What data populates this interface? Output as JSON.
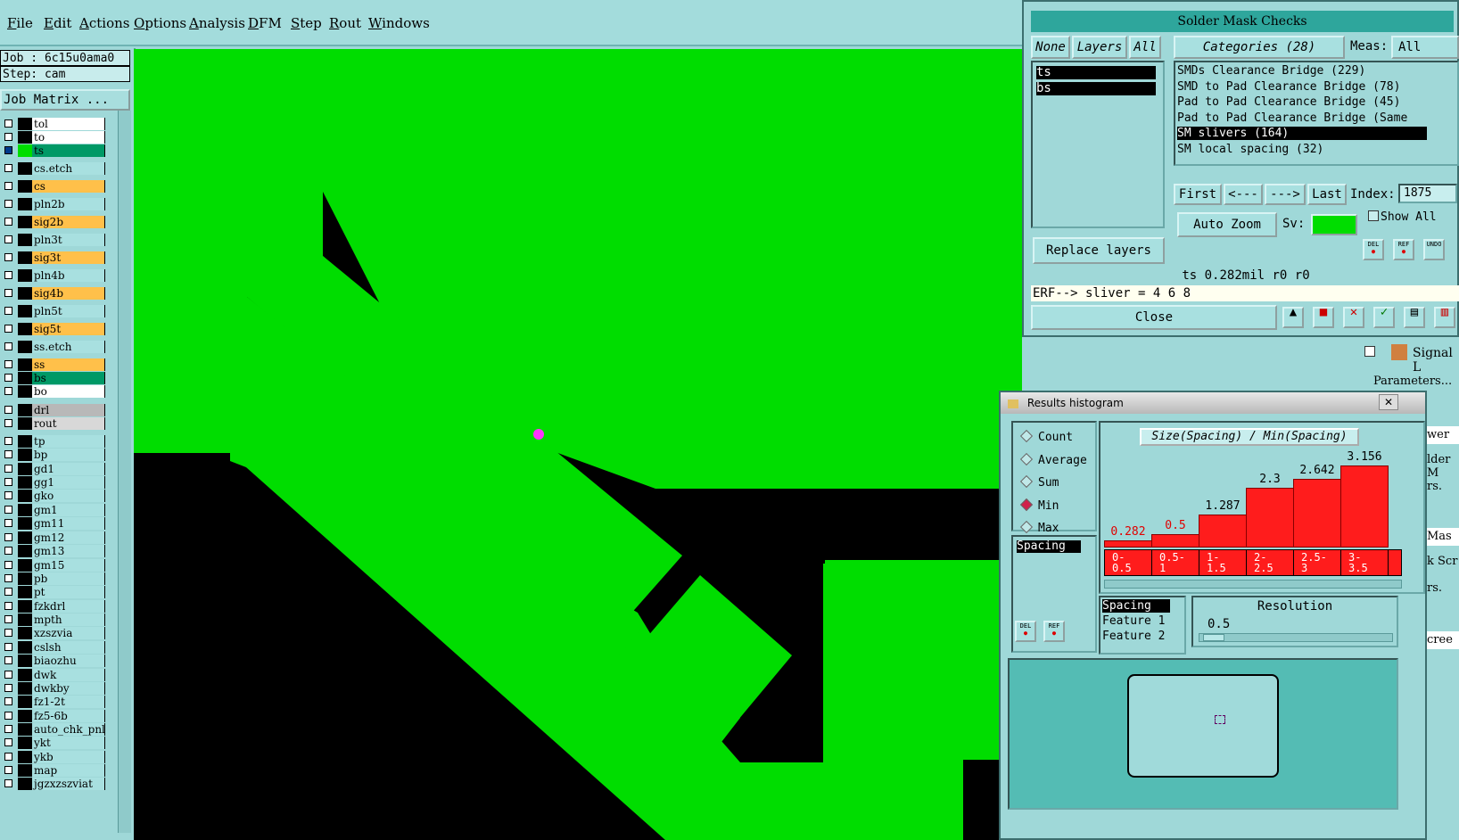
{
  "menu": [
    "File",
    "Edit",
    "Actions",
    "Options",
    "Analysis",
    "DFM",
    "Step",
    "Rout",
    "Windows"
  ],
  "job": {
    "job_line": "Job : 6c15u0ama0",
    "step_line": "Step: cam",
    "matrix_button": "Job Matrix ..."
  },
  "layers": [
    {
      "name": "tol",
      "color": "#ffffff",
      "checked": false
    },
    {
      "name": "to",
      "color": "#ffffff",
      "checked": false
    },
    {
      "name": "ts",
      "color": "#009966",
      "checked": true
    },
    {
      "name": "cs.etch",
      "color": "#a8e0e0",
      "checked": false
    },
    {
      "name": "cs",
      "color": "#ffc04a",
      "checked": false
    },
    {
      "name": "pln2b",
      "color": "#a8e0e0",
      "checked": false
    },
    {
      "name": "sig2b",
      "color": "#ffc04a",
      "checked": false
    },
    {
      "name": "pln3t",
      "color": "#a8e0e0",
      "checked": false
    },
    {
      "name": "sig3t",
      "color": "#ffc04a",
      "checked": false
    },
    {
      "name": "pln4b",
      "color": "#a8e0e0",
      "checked": false
    },
    {
      "name": "sig4b",
      "color": "#ffc04a",
      "checked": false
    },
    {
      "name": "pln5t",
      "color": "#a8e0e0",
      "checked": false
    },
    {
      "name": "sig5t",
      "color": "#ffc04a",
      "checked": false
    },
    {
      "name": "ss.etch",
      "color": "#a8e0e0",
      "checked": false
    },
    {
      "name": "ss",
      "color": "#ffc04a",
      "checked": false
    },
    {
      "name": "bs",
      "color": "#009966",
      "checked": false
    },
    {
      "name": "bo",
      "color": "#ffffff",
      "checked": false
    },
    {
      "name": "drl",
      "color": "#b8b8b8",
      "checked": false
    },
    {
      "name": "rout",
      "color": "#d8d8d8",
      "checked": false
    },
    {
      "name": "tp",
      "color": "#a8e0e0",
      "checked": false
    },
    {
      "name": "bp",
      "color": "#a8e0e0",
      "checked": false
    },
    {
      "name": "gd1",
      "color": "#a8e0e0",
      "checked": false
    },
    {
      "name": "gg1",
      "color": "#a8e0e0",
      "checked": false
    },
    {
      "name": "gko",
      "color": "#a8e0e0",
      "checked": false
    },
    {
      "name": "gm1",
      "color": "#a8e0e0",
      "checked": false
    },
    {
      "name": "gm11",
      "color": "#a8e0e0",
      "checked": false
    },
    {
      "name": "gm12",
      "color": "#a8e0e0",
      "checked": false
    },
    {
      "name": "gm13",
      "color": "#a8e0e0",
      "checked": false
    },
    {
      "name": "gm15",
      "color": "#a8e0e0",
      "checked": false
    },
    {
      "name": "pb",
      "color": "#a8e0e0",
      "checked": false
    },
    {
      "name": "pt",
      "color": "#a8e0e0",
      "checked": false
    },
    {
      "name": "fzkdrl",
      "color": "#a8e0e0",
      "checked": false
    },
    {
      "name": "mpth",
      "color": "#a8e0e0",
      "checked": false
    },
    {
      "name": "xzszvia",
      "color": "#a8e0e0",
      "checked": false
    },
    {
      "name": "cslsh",
      "color": "#a8e0e0",
      "checked": false
    },
    {
      "name": "biaozhu",
      "color": "#a8e0e0",
      "checked": false
    },
    {
      "name": "dwk",
      "color": "#a8e0e0",
      "checked": false
    },
    {
      "name": "dwkby",
      "color": "#a8e0e0",
      "checked": false
    },
    {
      "name": "fz1-2t",
      "color": "#a8e0e0",
      "checked": false
    },
    {
      "name": "fz5-6b",
      "color": "#a8e0e0",
      "checked": false
    },
    {
      "name": "auto_chk_pnl",
      "color": "#a8e0e0",
      "checked": false
    },
    {
      "name": "ykt",
      "color": "#a8e0e0",
      "checked": false
    },
    {
      "name": "ykb",
      "color": "#a8e0e0",
      "checked": false
    },
    {
      "name": "map",
      "color": "#a8e0e0",
      "checked": false
    },
    {
      "name": "jgzxzszviat",
      "color": "#a8e0e0",
      "checked": false
    }
  ],
  "sm": {
    "title": "Solder Mask Checks",
    "none": "None",
    "layers_btn": "Layers",
    "all": "All",
    "categories": "Categories (28)",
    "meas": "Meas:",
    "meas_value": "All",
    "layer_items": [
      "ts",
      "bs"
    ],
    "category_items": [
      "SMDs Clearance Bridge (229)",
      "SMD to Pad Clearance Bridge (78)",
      "Pad to Pad Clearance Bridge (45)",
      "Pad to Pad Clearance Bridge (Same",
      "SM slivers (164)",
      "SM local spacing (32)"
    ],
    "first": "First",
    "prev": "<---",
    "next": "--->",
    "last": "Last",
    "index_label": "Index:",
    "index_value": "1875",
    "auto_zoom": "Auto Zoom",
    "sv": "Sv:",
    "show_all": "Show All",
    "replace_layers": "Replace layers",
    "status": "ts 0.282mil  r0  r0",
    "erf": "ERF--> sliver = 4 6 8",
    "close": "Close",
    "del": "DEL",
    "ref": "REF",
    "undo": "UNDO"
  },
  "side": {
    "signal": "Signal L",
    "parameters": "Parameters...",
    "frag1": "wer",
    "frag2": "lder M",
    "frag3": "rs.",
    "frag4": "Mas",
    "frag5": "k Scr",
    "frag6": "rs.",
    "frag7": "cree"
  },
  "hist": {
    "title": "Results histogram",
    "radios": [
      {
        "label": "Count",
        "on": false
      },
      {
        "label": "Average",
        "on": false
      },
      {
        "label": "Sum",
        "on": false
      },
      {
        "label": "Min",
        "on": true
      },
      {
        "label": "Max",
        "on": false
      }
    ],
    "list_item": "Spacing",
    "chart_title": "Size(Spacing) / Min(Spacing)",
    "bottom_list": [
      "Spacing",
      "Feature 1",
      "Feature 2"
    ],
    "resolution_label": "Resolution",
    "resolution_value": "0.5",
    "del": "DEL",
    "ref": "REF"
  },
  "chart_data": {
    "type": "bar",
    "title": "Size(Spacing) / Min(Spacing)",
    "categories": [
      "0-\n0.5",
      "0.5-\n1",
      "1-\n1.5",
      "2-\n2.5",
      "2.5-\n3",
      "3-\n3.5"
    ],
    "values": [
      0.282,
      0.5,
      1.287,
      2.3,
      2.642,
      3.156
    ],
    "value_labels": [
      "0.282",
      "0.5",
      "1.287",
      "2.3",
      "2.642",
      "3.156"
    ],
    "ylim": [
      0,
      3.4
    ]
  }
}
